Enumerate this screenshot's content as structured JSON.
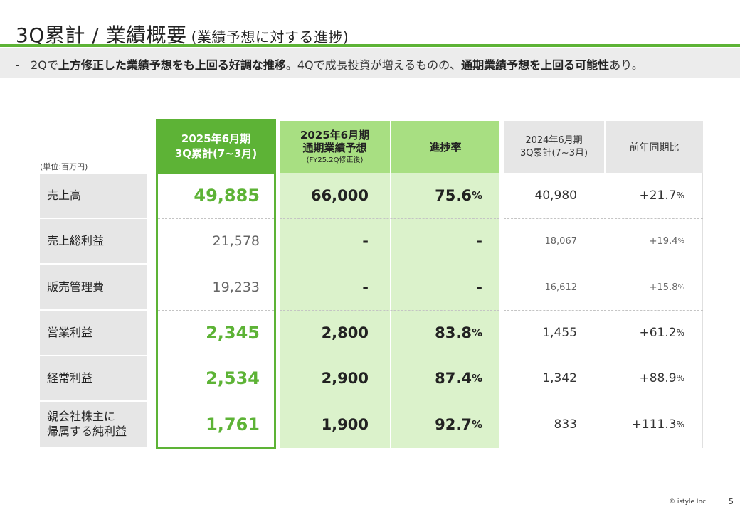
{
  "title": {
    "main": "3Q累計 / 業績概要",
    "sub": "(業績予想に対する進捗)"
  },
  "banner": {
    "prefix": "-",
    "parts": [
      {
        "t": "2Qで",
        "b": false
      },
      {
        "t": "上方修正した業績予想をも上回る好調な推移",
        "b": true
      },
      {
        "t": "。4Qで成長投資が増えるものの、",
        "b": false
      },
      {
        "t": "通期業績予想を上回る可能性",
        "b": true
      },
      {
        "t": "あり。",
        "b": false
      }
    ]
  },
  "unit": "(単位:百万円)",
  "headers": {
    "current": [
      "2025年6月期",
      "3Q累計(7~3月)"
    ],
    "forecast": [
      "2025年6月期",
      "通期業績予想"
    ],
    "forecast_note": "(FY25.2Q修正後)",
    "progress": "進捗率",
    "prev": [
      "2024年6月期",
      "3Q累計(7~3月)"
    ],
    "yoy": "前年同期比"
  },
  "rows": [
    {
      "label": [
        "売上高"
      ],
      "current": "49,885",
      "forecast": "66,000",
      "progress": "75.6",
      "prev": "40,980",
      "yoy": "+21.7",
      "emph": true
    },
    {
      "label": [
        "売上総利益"
      ],
      "current": "21,578",
      "forecast": "-",
      "progress": "-",
      "prev": "18,067",
      "yoy": "+19.4",
      "emph": false
    },
    {
      "label": [
        "販売管理費"
      ],
      "current": "19,233",
      "forecast": "-",
      "progress": "-",
      "prev": "16,612",
      "yoy": "+15.8",
      "emph": false
    },
    {
      "label": [
        "営業利益"
      ],
      "current": "2,345",
      "forecast": "2,800",
      "progress": "83.8",
      "prev": "1,455",
      "yoy": "+61.2",
      "emph": true
    },
    {
      "label": [
        "経常利益"
      ],
      "current": "2,534",
      "forecast": "2,900",
      "progress": "87.4",
      "prev": "1,342",
      "yoy": "+88.9",
      "emph": true
    },
    {
      "label": [
        "親会社株主に",
        "帰属する純利益"
      ],
      "current": "1,761",
      "forecast": "1,900",
      "progress": "92.7",
      "prev": "833",
      "yoy": "+111.3",
      "emph": true
    }
  ],
  "percent_sign": "%",
  "footer": {
    "copyright": "© istyle Inc.",
    "page": "5"
  },
  "colors": {
    "accent": "#5db336",
    "light_green": "#a8df82",
    "pale_green": "#dbf2cb",
    "gray": "#e6e6e6"
  }
}
